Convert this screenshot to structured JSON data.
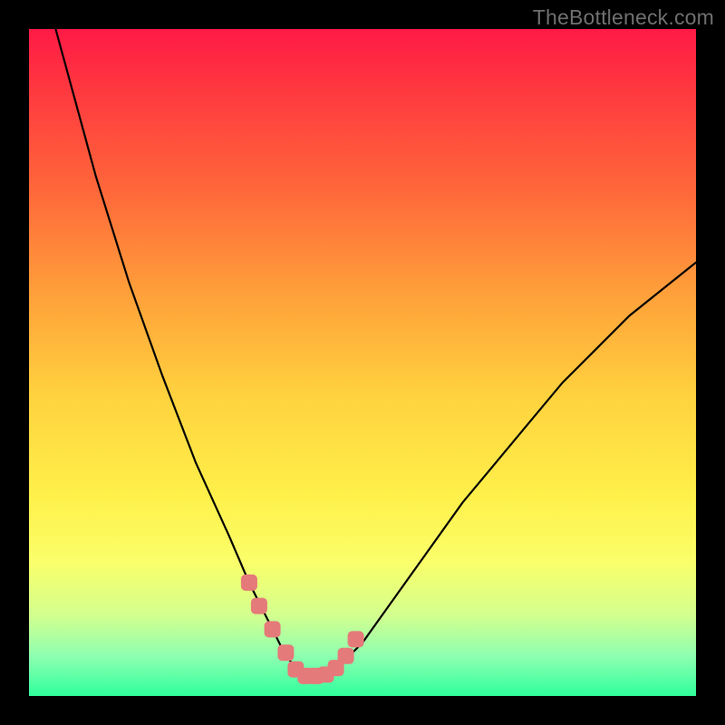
{
  "watermark": "TheBottleneck.com",
  "chart_data": {
    "type": "line",
    "title": "",
    "xlabel": "",
    "ylabel": "",
    "xlim": [
      0,
      100
    ],
    "ylim": [
      0,
      100
    ],
    "grid": false,
    "legend": false,
    "series": [
      {
        "name": "bottleneck-curve",
        "color": "#000000",
        "x": [
          4,
          10,
          15,
          20,
          25,
          30,
          33,
          36,
          38,
          40,
          42,
          44,
          46,
          50,
          55,
          60,
          65,
          70,
          75,
          80,
          85,
          90,
          95,
          100
        ],
        "y": [
          100,
          78,
          62,
          48,
          35,
          24,
          17,
          11,
          7,
          4,
          3,
          3,
          4,
          8,
          15,
          22,
          29,
          35,
          41,
          47,
          52,
          57,
          61,
          65
        ]
      },
      {
        "name": "highlight-markers",
        "color": "#e57a7a",
        "marker": "square-rounded",
        "x": [
          33.0,
          34.5,
          36.5,
          38.5,
          40.0,
          41.5,
          43.0,
          44.5,
          46.0,
          47.5,
          49.0
        ],
        "y": [
          17.0,
          13.5,
          10.0,
          6.5,
          4.0,
          3.0,
          3.0,
          3.2,
          4.2,
          6.0,
          8.5
        ]
      }
    ],
    "background_gradient": {
      "type": "vertical",
      "stops": [
        {
          "pos": 0.0,
          "color": "#ff1a45"
        },
        {
          "pos": 0.25,
          "color": "#ff6a3a"
        },
        {
          "pos": 0.55,
          "color": "#ffd23e"
        },
        {
          "pos": 0.8,
          "color": "#faff6a"
        },
        {
          "pos": 1.0,
          "color": "#2fff9d"
        }
      ]
    }
  }
}
